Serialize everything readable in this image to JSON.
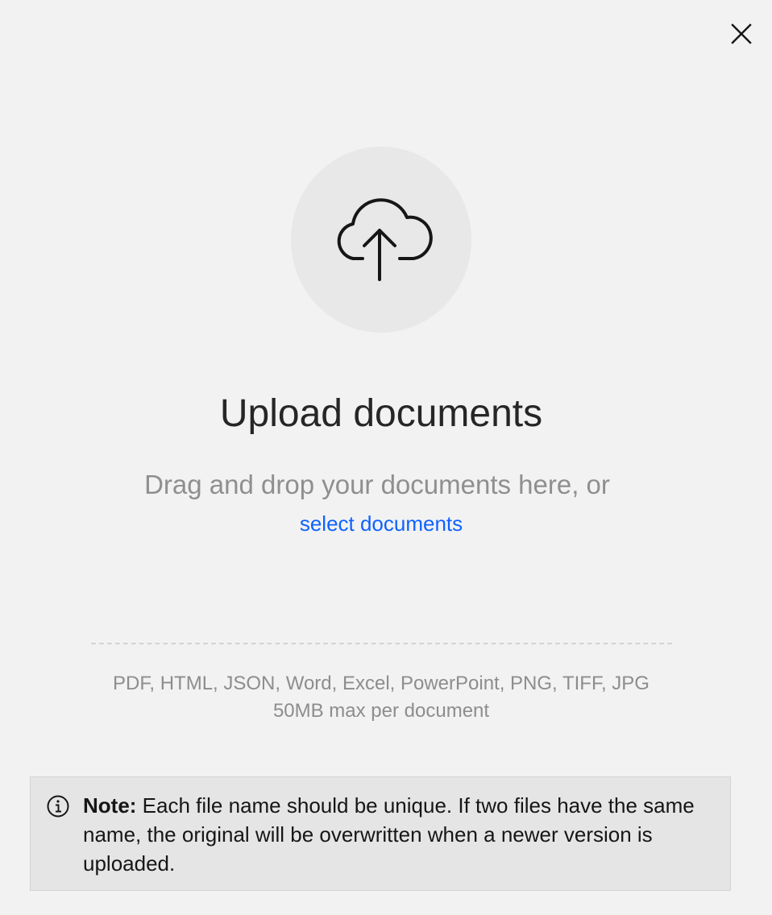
{
  "header": {
    "close_icon": "close-icon"
  },
  "dropzone": {
    "icon": "cloud-upload-icon",
    "title": "Upload documents",
    "subtitle": "Drag and drop your documents here, or",
    "select_link": "select documents",
    "formats": "PDF, HTML, JSON, Word, Excel, PowerPoint, PNG, TIFF, JPG",
    "max_size": "50MB max per document"
  },
  "note": {
    "icon": "info-icon",
    "label": "Note:",
    "text": " Each file name should be unique. If two files have the same name, the original will be overwritten when a newer version is uploaded."
  },
  "colors": {
    "background": "#f2f2f2",
    "link": "#0f62fe",
    "note_background": "#e5e5e5",
    "muted_text": "#8d8d8d"
  }
}
